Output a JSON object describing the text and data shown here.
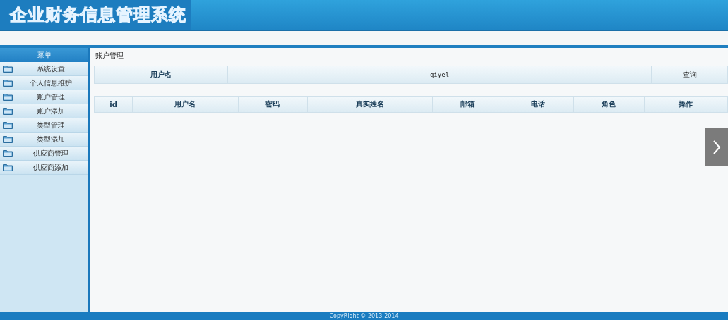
{
  "header": {
    "title": "企业财务信息管理系统"
  },
  "sidebar": {
    "title": "菜单",
    "items": [
      {
        "label": "系统设置"
      },
      {
        "label": "个人信息维护"
      },
      {
        "label": "账户管理"
      },
      {
        "label": "账户添加"
      },
      {
        "label": "类型管理"
      },
      {
        "label": "类型添加"
      },
      {
        "label": "供应商管理"
      },
      {
        "label": "供应商添加"
      }
    ]
  },
  "content": {
    "breadcrumb": "账户管理",
    "search": {
      "label": "用户名",
      "value": "qiyel",
      "button": "查询"
    },
    "table": {
      "columns": [
        "id",
        "用户名",
        "密码",
        "真实姓名",
        "邮箱",
        "电话",
        "角色",
        "操作"
      ]
    }
  },
  "footer": {
    "text": "CopyRight © 2013-2014"
  }
}
